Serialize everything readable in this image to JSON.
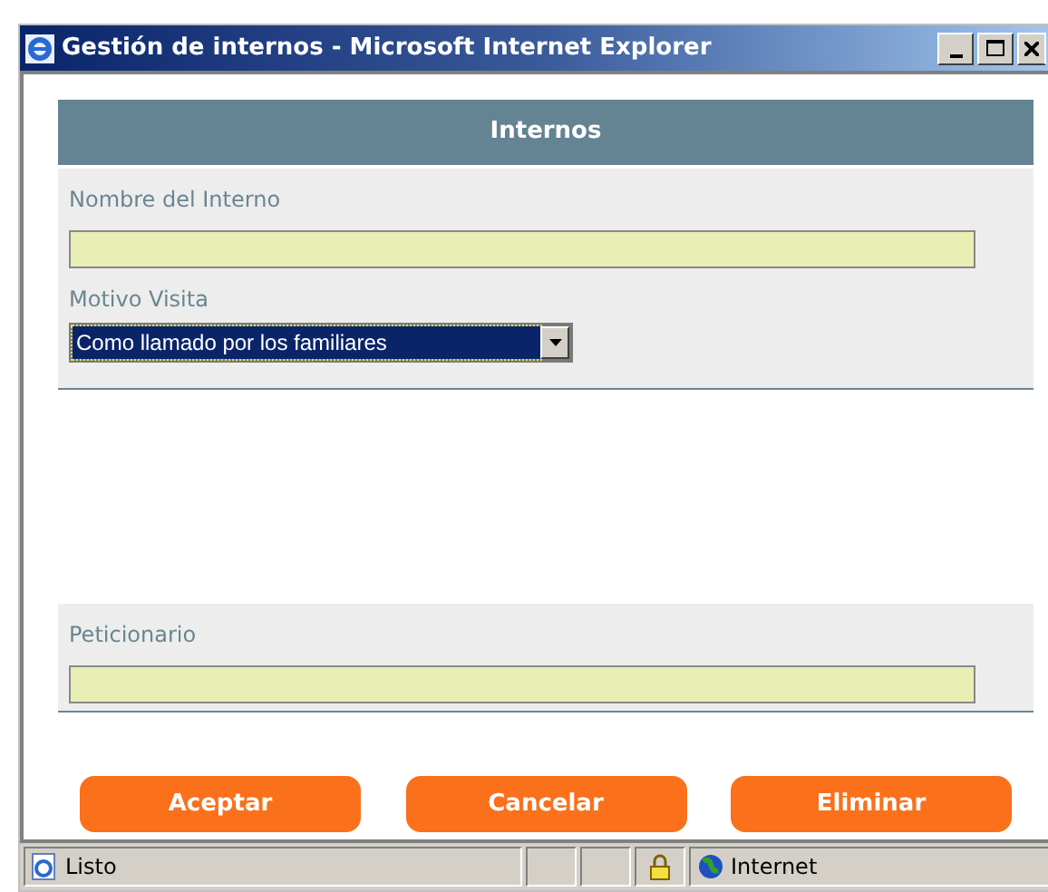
{
  "window": {
    "title": "Gestión de internos - Microsoft Internet Explorer"
  },
  "header": {
    "title": "Internos"
  },
  "fields": [
    {
      "label": "Nombre del Interno",
      "kind": "text"
    },
    {
      "label": "Motivo Visita",
      "kind": "select",
      "value": "Como llamado por los familiares",
      "focused": true
    }
  ],
  "petitioner": {
    "label": "Peticionario"
  },
  "buttons": [
    "Aceptar",
    "Cancelar",
    "Eliminar"
  ],
  "status_bar": {
    "text": "Listo",
    "zone": "Internet"
  }
}
